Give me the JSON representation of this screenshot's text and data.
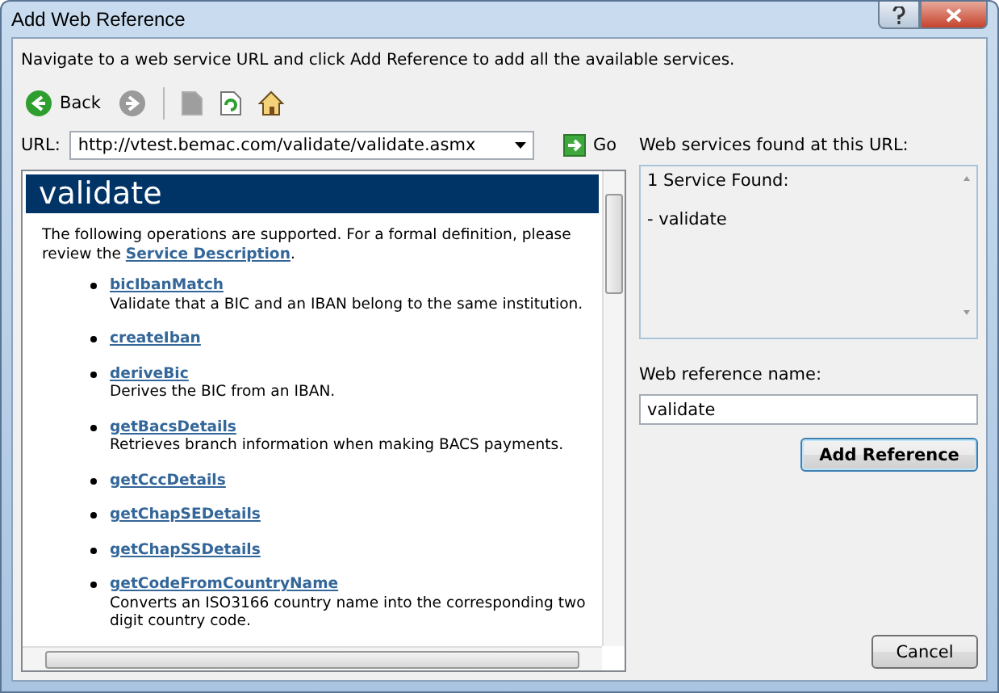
{
  "window": {
    "title": "Add Web Reference"
  },
  "instructions": "Navigate to a web service URL and click Add Reference to add all the available services.",
  "toolbar": [
    {
      "kind": "back",
      "label": "Back",
      "disabled": false
    },
    {
      "kind": "forward",
      "disabled": true
    },
    {
      "kind": "stop",
      "disabled": true
    },
    {
      "kind": "refresh",
      "disabled": false
    },
    {
      "kind": "home",
      "disabled": false
    }
  ],
  "url": {
    "label": "URL:",
    "value": "http://vtest.bemac.com/validate/validate.asmx",
    "go": "Go"
  },
  "browser": {
    "heading": "validate",
    "intro": {
      "text": "The following operations are supported. For a formal definition, please review the ",
      "link": "Service Description",
      "after": "."
    },
    "operations": [
      {
        "name": "bicIbanMatch",
        "description": "Validate that a BIC and an IBAN belong to the same institution."
      },
      {
        "name": "createIban"
      },
      {
        "name": "deriveBic",
        "description": "Derives the BIC from an IBAN."
      },
      {
        "name": "getBacsDetails",
        "description": "Retrieves branch information when making BACS payments."
      },
      {
        "name": "getCccDetails"
      },
      {
        "name": "getChapSEDetails"
      },
      {
        "name": "getChapSSDetails"
      },
      {
        "name": "getCodeFromCountryName",
        "description": "Converts an ISO3166 country name into the corresponding two digit country code."
      }
    ]
  },
  "services": {
    "label": "Web services found at this URL:",
    "lines": [
      "1 Service Found:",
      "- validate"
    ]
  },
  "reference_name": {
    "label": "Web reference name:",
    "value": "validate"
  },
  "buttons": {
    "add": "Add Reference",
    "cancel": "Cancel"
  }
}
